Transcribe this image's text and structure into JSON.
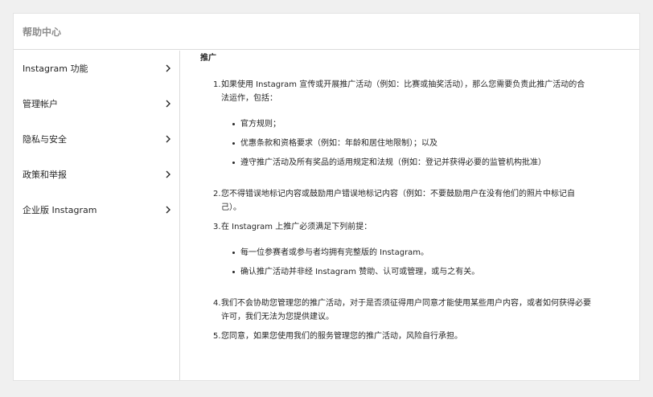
{
  "header": {
    "title": "帮助中心"
  },
  "sidebar": {
    "items": [
      {
        "label": "Instagram 功能"
      },
      {
        "label": "管理帐户"
      },
      {
        "label": "隐私与安全"
      },
      {
        "label": "政策和举报"
      },
      {
        "label": "企业版 Instagram"
      }
    ]
  },
  "content": {
    "heading": "推广",
    "items": [
      {
        "num": "1.",
        "text": "如果使用 Instagram 宣传或开展推广活动（例如：比赛或抽奖活动），那么您需要负责此推广活动的合法运作，包括：",
        "sub": [
          "官方规则；",
          "优惠条款和资格要求（例如：年龄和居住地限制）；以及",
          "遵守推广活动及所有奖品的适用规定和法规（例如：登记并获得必要的监管机构批准）"
        ]
      },
      {
        "num": "2.",
        "text": "您不得错误地标记内容或鼓励用户错误地标记内容（例如：不要鼓励用户在没有他们的照片中标记自己）。"
      },
      {
        "num": "3.",
        "text": "在 Instagram 上推广必须满足下列前提：",
        "sub": [
          "每一位参赛者或参与者均拥有完整版的 Instagram。",
          "确认推广活动并非经 Instagram 赞助、认可或管理，或与之有关。"
        ]
      },
      {
        "num": "4.",
        "text": "我们不会协助您管理您的推广活动，对于是否须征得用户同意才能使用某些用户内容，或者如何获得必要许可，我们无法为您提供建议。"
      },
      {
        "num": "5.",
        "text": "您同意，如果您使用我们的服务管理您的推广活动，风险自行承担。"
      }
    ]
  }
}
